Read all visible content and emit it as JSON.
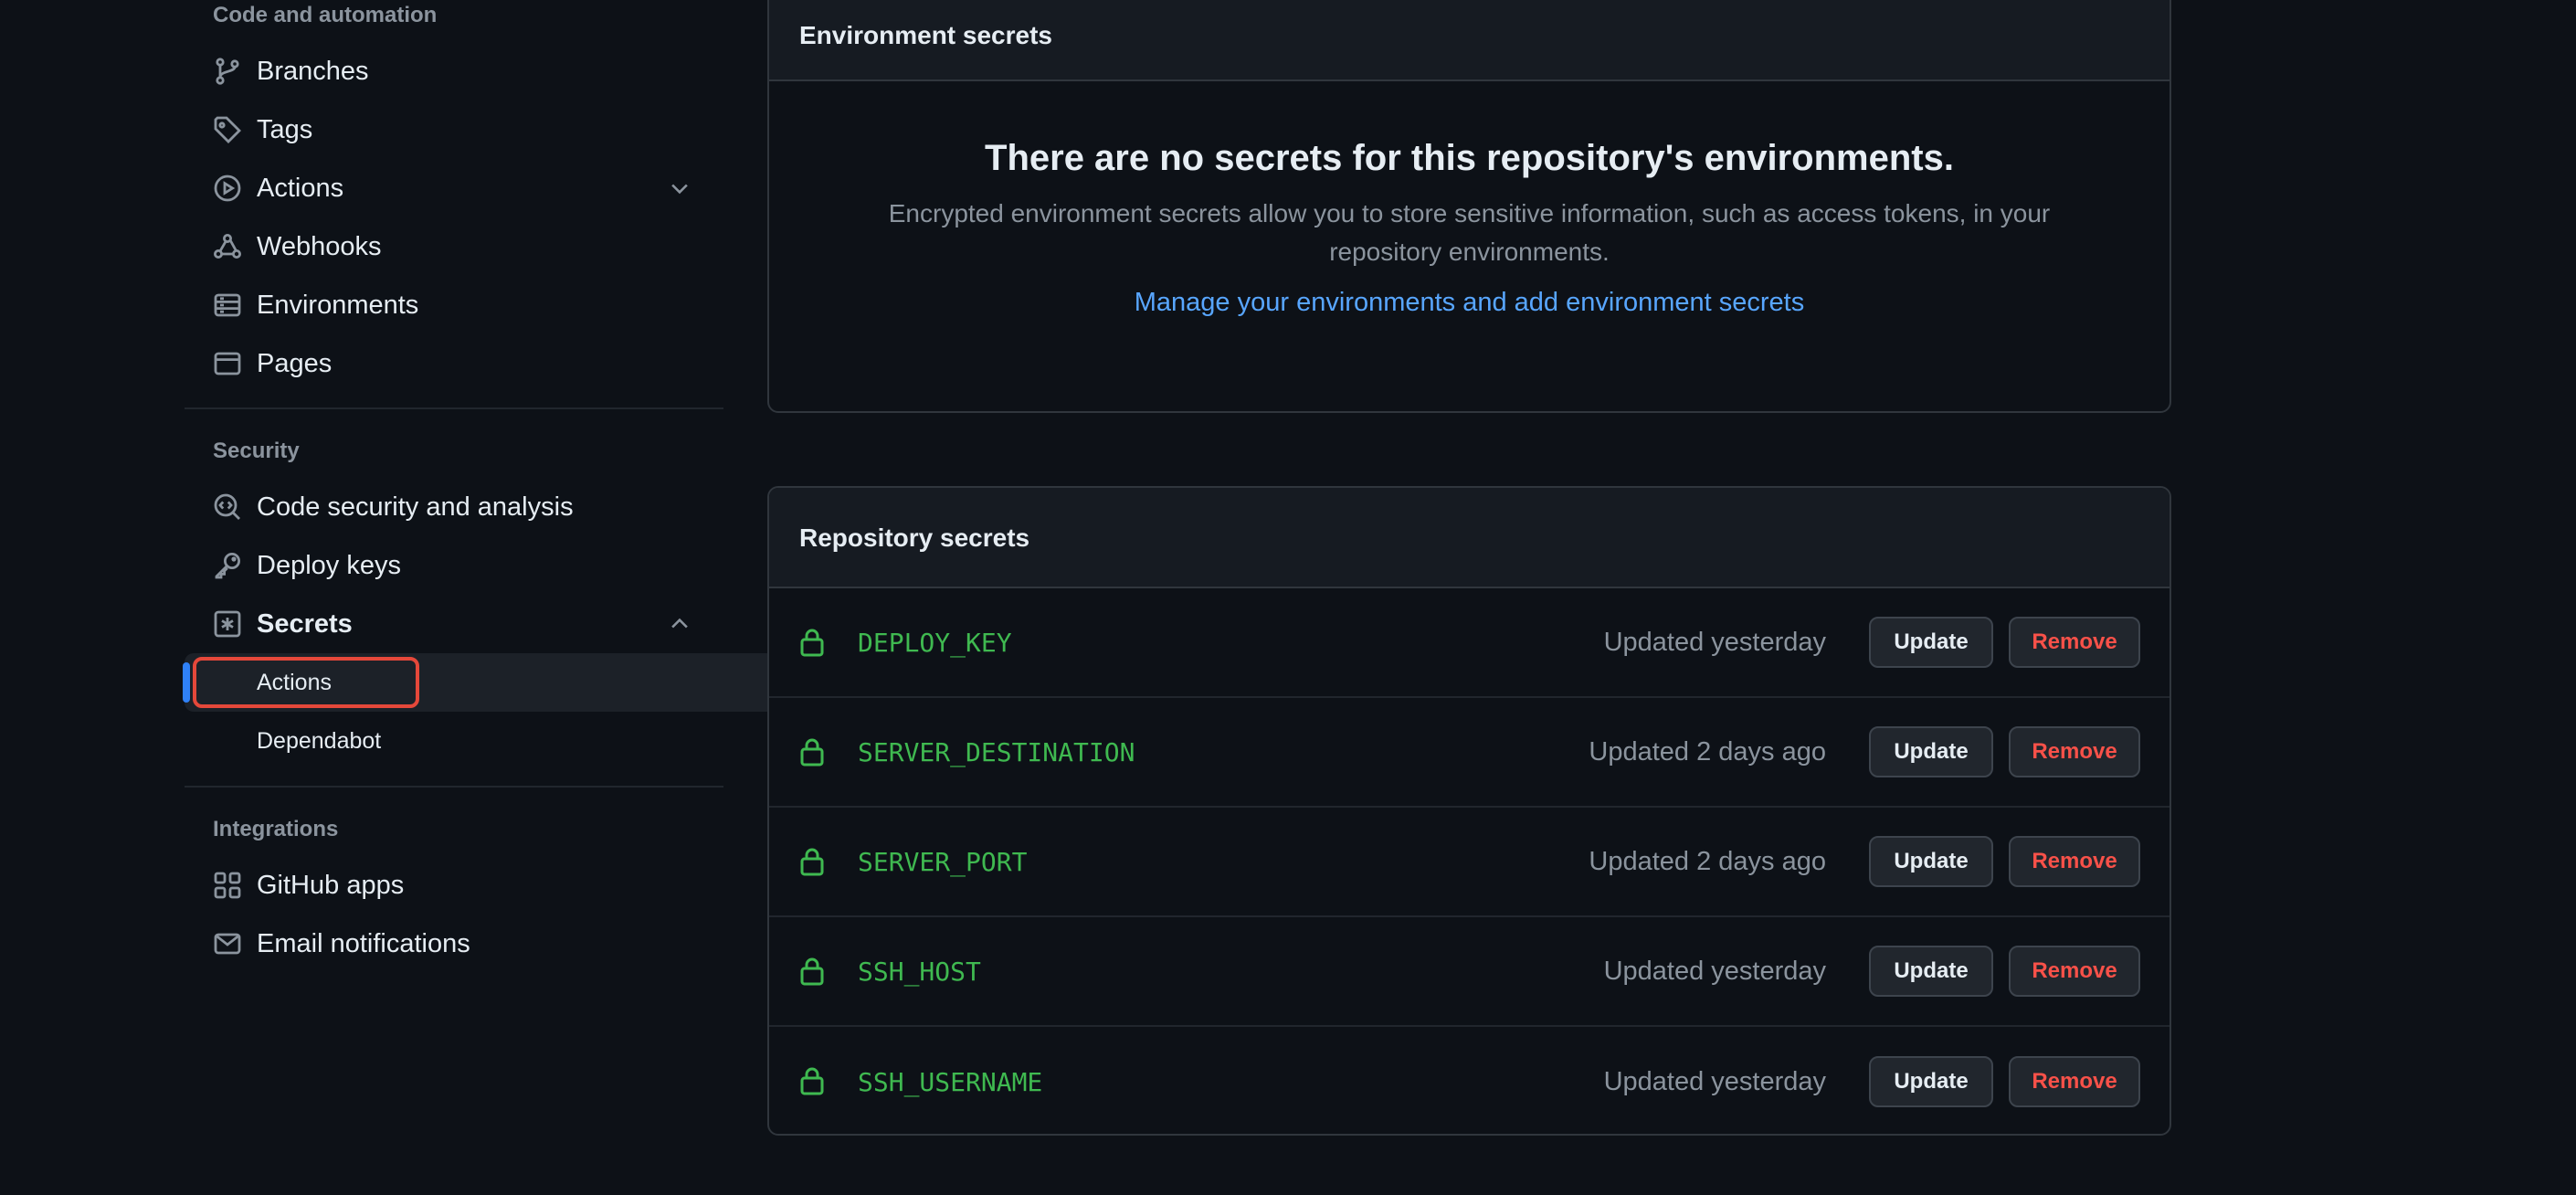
{
  "sidebar": {
    "code_heading": "Code and automation",
    "code_items": [
      {
        "label": "Branches",
        "icon": "git-branch-icon"
      },
      {
        "label": "Tags",
        "icon": "tag-icon"
      },
      {
        "label": "Actions",
        "icon": "play-icon"
      },
      {
        "label": "Webhooks",
        "icon": "webhook-icon"
      },
      {
        "label": "Environments",
        "icon": "server-icon"
      },
      {
        "label": "Pages",
        "icon": "browser-icon"
      }
    ],
    "security_heading": "Security",
    "security_items": [
      {
        "label": "Code security and analysis",
        "icon": "codescan-icon"
      },
      {
        "label": "Deploy keys",
        "icon": "key-icon"
      },
      {
        "label": "Secrets",
        "icon": "asterisk-box-icon"
      }
    ],
    "secrets_sub": [
      {
        "label": "Actions",
        "active": true
      },
      {
        "label": "Dependabot",
        "active": false
      }
    ],
    "integrations_heading": "Integrations",
    "integration_items": [
      {
        "label": "GitHub apps",
        "icon": "apps-icon"
      },
      {
        "label": "Email notifications",
        "icon": "mail-icon"
      }
    ]
  },
  "env_secrets": {
    "header": "Environment secrets",
    "blank_title": "There are no secrets for this repository's environments.",
    "blank_text": "Encrypted environment secrets allow you to store sensitive information, such as access tokens, in your repository environments.",
    "link": "Manage your environments and add environment secrets"
  },
  "repo_secrets": {
    "header": "Repository secrets",
    "update_label": "Update",
    "remove_label": "Remove",
    "rows": [
      {
        "name": "DEPLOY_KEY",
        "updated": "Updated yesterday"
      },
      {
        "name": "SERVER_DESTINATION",
        "updated": "Updated 2 days ago"
      },
      {
        "name": "SERVER_PORT",
        "updated": "Updated 2 days ago"
      },
      {
        "name": "SSH_HOST",
        "updated": "Updated yesterday"
      },
      {
        "name": "SSH_USERNAME",
        "updated": "Updated yesterday"
      }
    ]
  },
  "colors": {
    "background": "#0d1117",
    "secret_name": "#3fb950",
    "link": "#58a6ff",
    "remove": "#f85149",
    "highlight_box": "#e5483a",
    "active_bar": "#2f81f7"
  }
}
